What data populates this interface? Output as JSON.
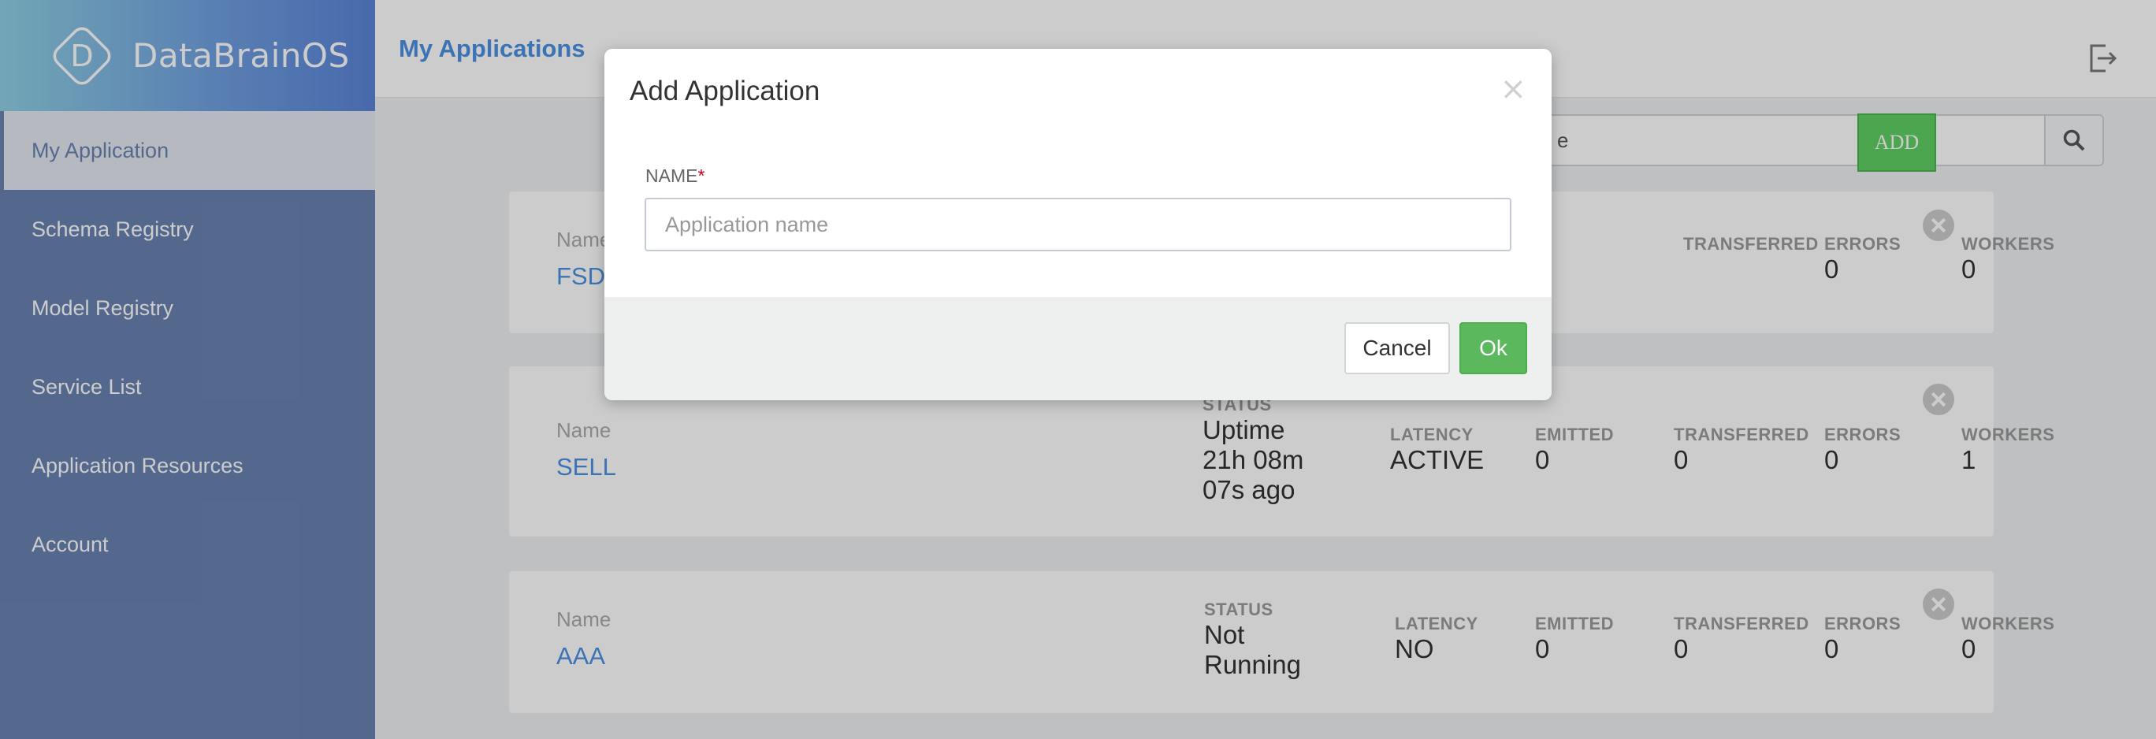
{
  "app": {
    "logo_text": "DataBrainOS",
    "logo_letter": "D"
  },
  "sidebar": {
    "items": [
      {
        "label": "My Application",
        "active": true
      },
      {
        "label": "Schema Registry"
      },
      {
        "label": "Model Registry"
      },
      {
        "label": "Service List"
      },
      {
        "label": "Application Resources"
      },
      {
        "label": "Account"
      }
    ]
  },
  "header": {
    "title": "My Applications"
  },
  "toolbar": {
    "search_value": "e",
    "add_label": "ADD"
  },
  "applications": [
    {
      "name_label": "Name",
      "name": "FSD",
      "status_label": "",
      "status": "",
      "latency_label": "",
      "latency": "",
      "emitted_label": "",
      "emitted": "",
      "transferred_label": "TRANSFERRED",
      "transferred": "",
      "errors_label": "ERRORS",
      "errors": "0",
      "workers_label": "WORKERS",
      "workers": "0"
    },
    {
      "name_label": "Name",
      "name": "SELL",
      "status_label": "STATUS",
      "status": "Uptime 21h 08m 07s ago",
      "latency_label": "LATENCY",
      "latency": "ACTIVE",
      "emitted_label": "EMITTED",
      "emitted": "0",
      "transferred_label": "TRANSFERRED",
      "transferred": "0",
      "errors_label": "ERRORS",
      "errors": "0",
      "workers_label": "WORKERS",
      "workers": "1"
    },
    {
      "name_label": "Name",
      "name": "AAA",
      "status_label": "STATUS",
      "status": "Not Running",
      "latency_label": "LATENCY",
      "latency": "NO",
      "emitted_label": "EMITTED",
      "emitted": "0",
      "transferred_label": "TRANSFERRED",
      "transferred": "0",
      "errors_label": "ERRORS",
      "errors": "0",
      "workers_label": "WORKERS",
      "workers": "0"
    }
  ],
  "modal": {
    "title": "Add Application",
    "close_glyph": "×",
    "field_label": "NAME",
    "required_mark": "*",
    "name_placeholder": "Application name",
    "cancel_label": "Cancel",
    "ok_label": "Ok"
  },
  "colors": {
    "sidebar": "#6983b2",
    "accent": "#4a90e2",
    "add_button": "#5fcf63",
    "ok_button": "#5cb85c"
  }
}
